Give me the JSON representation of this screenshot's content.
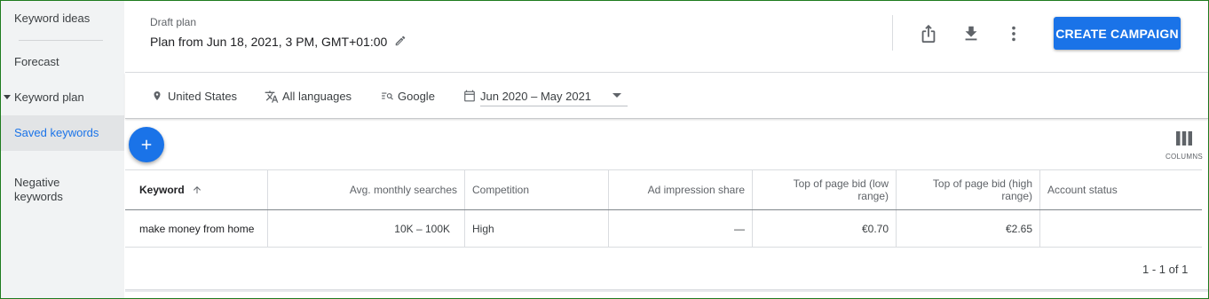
{
  "sidebar": {
    "items": [
      {
        "label": "Keyword ideas"
      },
      {
        "label": "Forecast"
      },
      {
        "label": "Keyword plan"
      },
      {
        "label": "Saved keywords"
      },
      {
        "label": "Negative\nkeywords"
      }
    ]
  },
  "header": {
    "draft_label": "Draft plan",
    "plan_title": "Plan from Jun 18, 2021, 3 PM, GMT+01:00",
    "create_button": "CREATE CAMPAIGN"
  },
  "filters": {
    "location": "United States",
    "language": "All languages",
    "network": "Google",
    "date_range": "Jun 2020 – May 2021"
  },
  "toolbar": {
    "columns_label": "COLUMNS"
  },
  "table": {
    "headers": [
      "Keyword",
      "Avg. monthly searches",
      "Competition",
      "Ad impression share",
      "Top of page bid (low range)",
      "Top of page bid (high range)",
      "Account status"
    ],
    "rows": [
      [
        "make money from home",
        "10K – 100K",
        "High",
        "—",
        "€0.70",
        "€2.65",
        ""
      ]
    ]
  },
  "pager": "1 - 1 of 1",
  "colors": {
    "accent": "#1a73e8",
    "sidebar_bg": "#f1f3f4",
    "frame": "#1e7b1e"
  }
}
